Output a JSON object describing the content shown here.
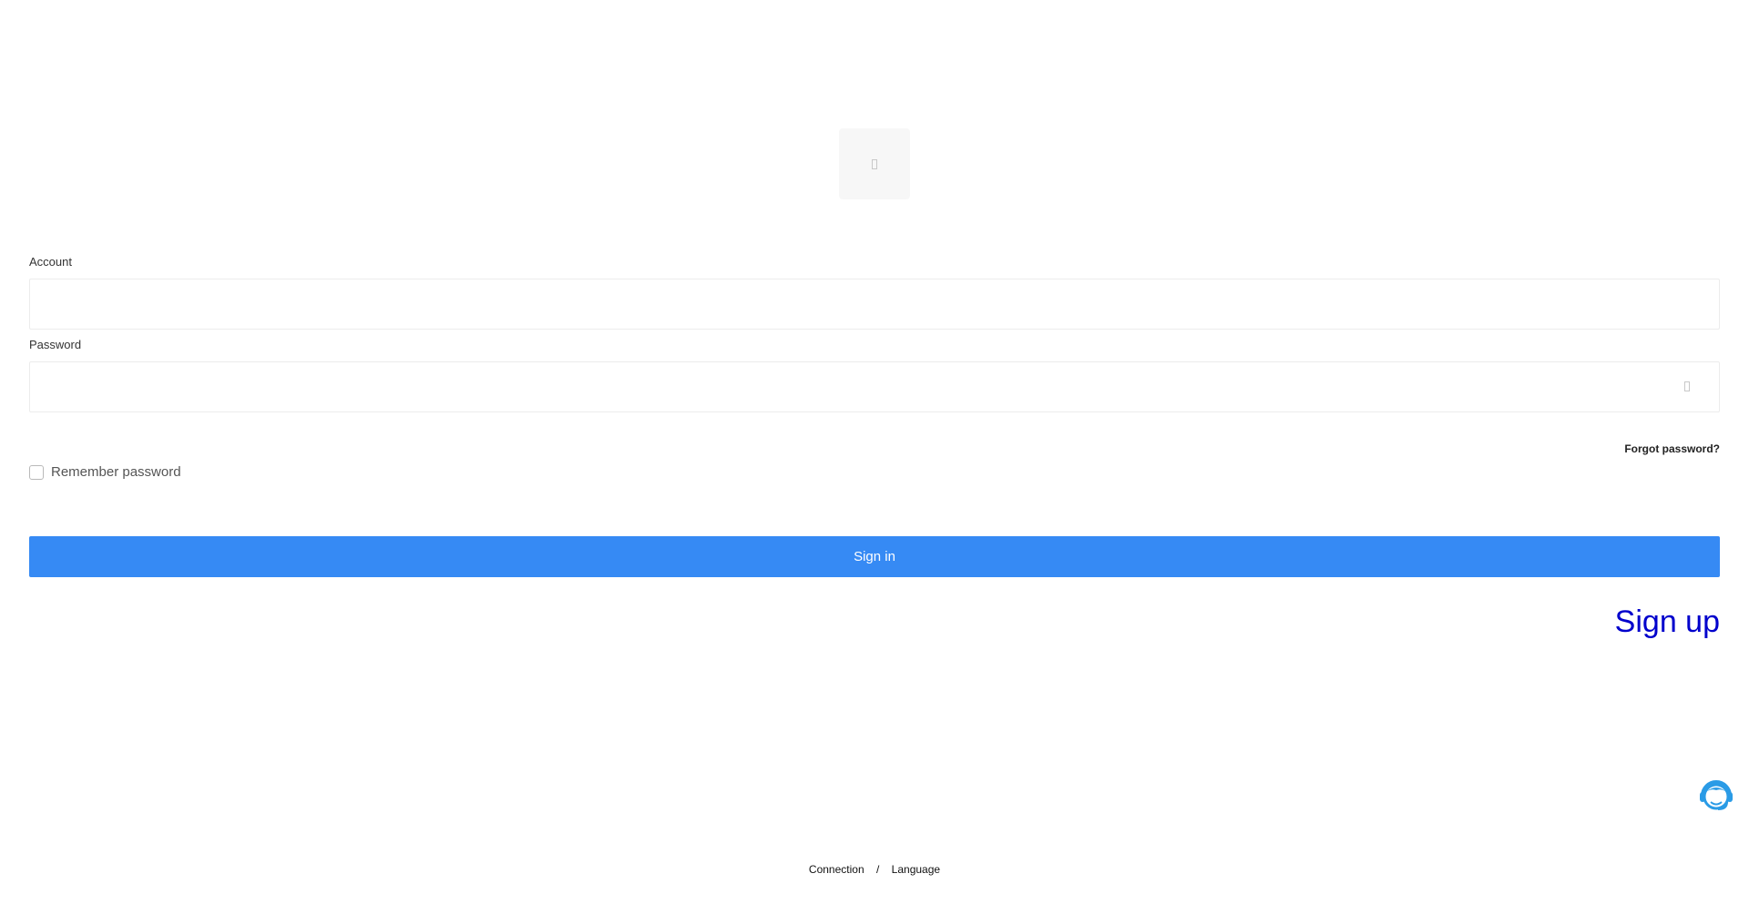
{
  "form": {
    "account_label": "Account",
    "account_value": "",
    "password_label": "Password",
    "password_value": "",
    "forgot_password": "Forgot password?",
    "remember_label": "Remember password",
    "remember_checked": false,
    "signin_label": "Sign in",
    "signup_label": "Sign up"
  },
  "footer": {
    "connection": "Connection",
    "separator": "/",
    "language": "Language"
  },
  "colors": {
    "primary": "#368af4",
    "link": "#0000cc",
    "support": "#2a9be6"
  },
  "icons": {
    "logo": "logo-icon",
    "password_toggle": "eye-icon",
    "support": "headset-support-icon"
  }
}
